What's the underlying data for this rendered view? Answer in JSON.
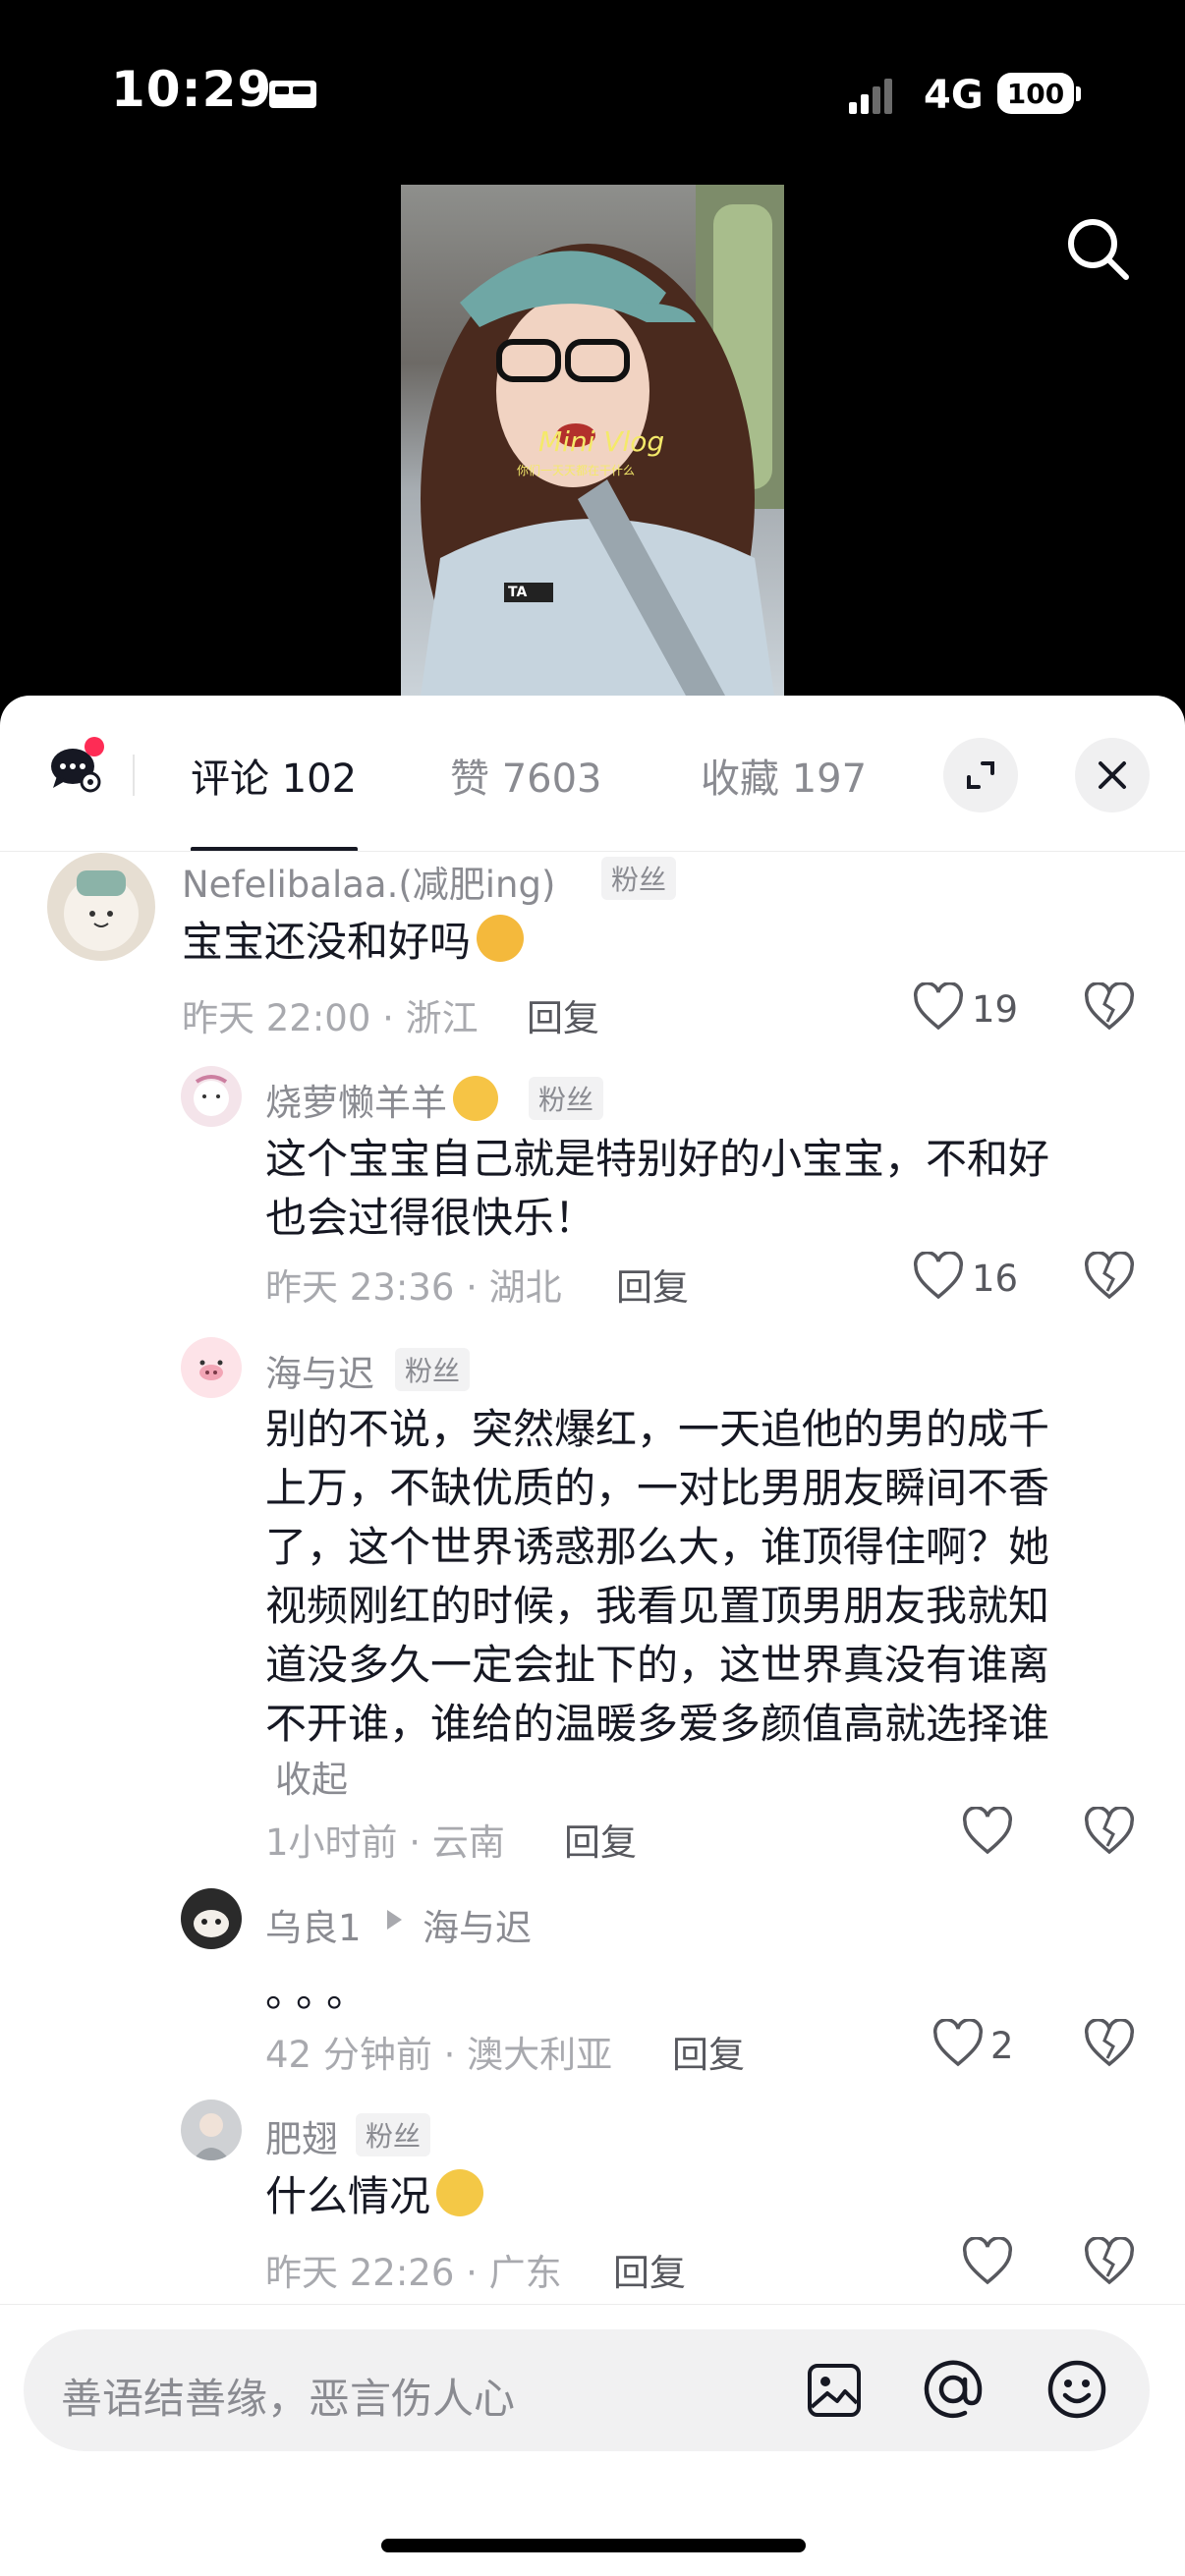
{
  "status_bar": {
    "time": "10:29",
    "network": "4G",
    "battery": "100"
  },
  "video": {
    "overlay_title": "Mini Vlog",
    "overlay_subtitle": "你们一天天都在干什么",
    "jacket_text": "TA"
  },
  "tabs": [
    {
      "label": "评论 102",
      "active": true
    },
    {
      "label": "赞 7603",
      "active": false
    },
    {
      "label": "收藏 197",
      "active": false
    }
  ],
  "comments": [
    {
      "name": "Nefelibalaa.(减肥ing)",
      "badge": "粉丝",
      "text": "宝宝还没和好吗",
      "meta": "昨天 22:00 · 浙江",
      "reply": "回复",
      "likes": "19"
    },
    {
      "name": "烧萝懒羊羊",
      "badge": "粉丝",
      "text_lines": [
        "这个宝宝自己就是特别好的小宝宝，不和好",
        "也会过得很快乐！"
      ],
      "meta": "昨天 23:36 · 湖北",
      "reply": "回复",
      "likes": "16"
    },
    {
      "name": "海与迟",
      "badge": "粉丝",
      "text_lines": [
        "别的不说，突然爆红，一天追他的男的成千",
        "上万，不缺优质的，一对比男朋友瞬间不香",
        "了，这个世界诱惑那么大，谁顶得住啊？她",
        "视频刚红的时候，我看见置顶男朋友我就知",
        "道没多久一定会扯下的，这世界真没有谁离",
        "不开谁，谁给的温暖多爱多颜值高就选择谁"
      ],
      "collapse": "收起",
      "meta": "1小时前 · 云南",
      "reply": "回复",
      "likes": ""
    },
    {
      "name": "乌良1",
      "reply_to": "海与迟",
      "text": "。。。",
      "meta": "42 分钟前 · 澳大利亚",
      "reply": "回复",
      "likes": "2"
    },
    {
      "name": "肥翅",
      "badge": "粉丝",
      "text": "什么情况",
      "meta": "昨天 22:26 · 广东",
      "reply": "回复",
      "likes": ""
    }
  ],
  "input": {
    "placeholder": "善语结善缘，恶言伤人心"
  },
  "colors": {
    "accent": "#fe2c55",
    "text": "#161823",
    "muted": "#8a8b91"
  }
}
